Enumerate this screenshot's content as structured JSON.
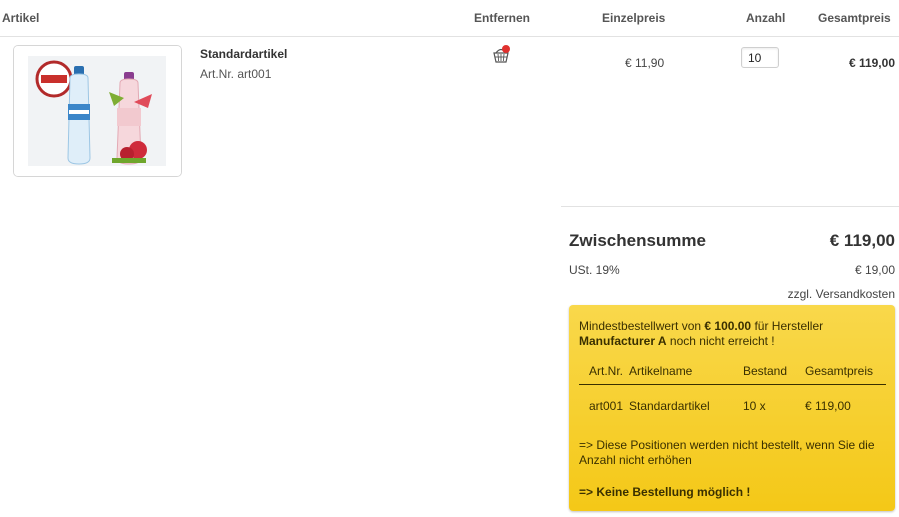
{
  "table_header": {
    "article": "Artikel",
    "remove": "Entfernen",
    "unit_price": "Einzelpreis",
    "quantity": "Anzahl",
    "total_price": "Gesamtpreis"
  },
  "product": {
    "name": "Standardartikel",
    "art_nr": "Art.Nr. art001",
    "unit_price": "€ 11,90",
    "quantity": "10",
    "total_price": "€ 119,00",
    "remove_icon": "basket-remove-icon",
    "image_icon": "water-bottles-image"
  },
  "summary": {
    "subtotal_label": "Zwischensumme",
    "subtotal_value": "€ 119,00",
    "vat_label": "USt. 19%",
    "vat_value": "€ 19,00",
    "shipping_note": "zzgl. Versandkosten"
  },
  "notice": {
    "prefix": "Mindestbestellwert von ",
    "min_value": "€ 100.00",
    "middle": " für Hersteller ",
    "manufacturer": "Manufacturer A",
    "suffix": " noch nicht erreicht !",
    "table": {
      "headers": [
        "Art.Nr.",
        "Artikelname",
        "Bestand",
        "Gesamtpreis"
      ],
      "rows": [
        [
          "art001",
          "Standardartikel",
          "10 x",
          "€ 119,00"
        ]
      ]
    },
    "info": "=> Diese Positionen werden nicht bestellt, wenn Sie die Anzahl nicht erhöhen",
    "final": "=> Keine Bestellung möglich !"
  },
  "colors": {
    "notice_bg": "#f6cf2a",
    "text": "#333333",
    "remove_badge": "#e0312e"
  }
}
